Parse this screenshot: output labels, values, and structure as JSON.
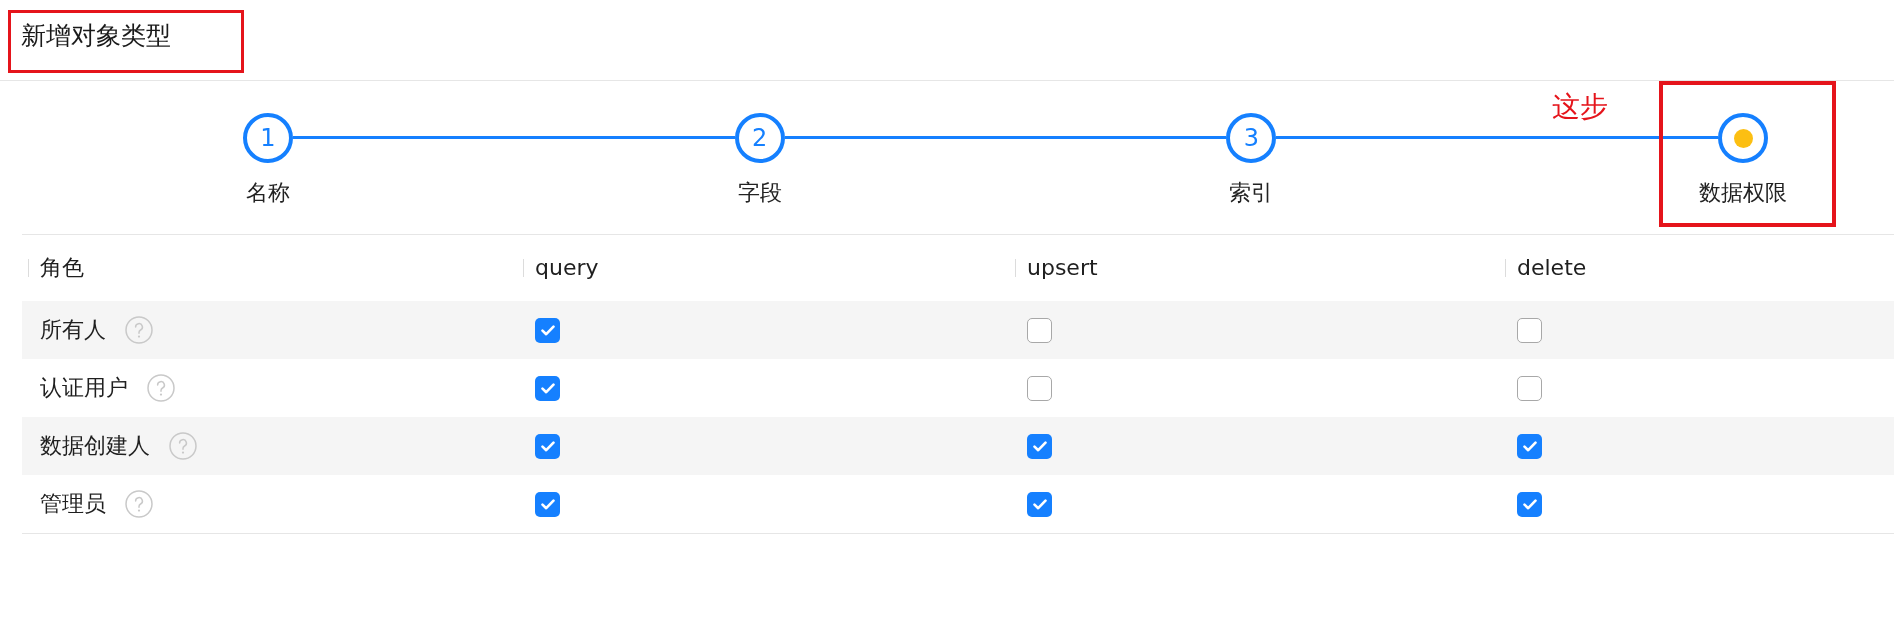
{
  "title": {
    "text": "新增对象类型",
    "highlighted": true
  },
  "steps": [
    {
      "number": "1",
      "label": "名称",
      "current": false,
      "highlighted": false
    },
    {
      "number": "2",
      "label": "字段",
      "current": false,
      "highlighted": false
    },
    {
      "number": "3",
      "label": "索引",
      "current": false,
      "highlighted": false
    },
    {
      "label": "数据权限",
      "current": true,
      "highlighted": true,
      "annotation": "这步"
    }
  ],
  "table": {
    "columns": [
      "角色",
      "query",
      "upsert",
      "delete"
    ],
    "rows": [
      {
        "role": "所有人",
        "help": true,
        "checks": [
          true,
          false,
          false
        ]
      },
      {
        "role": "认证用户",
        "help": true,
        "checks": [
          true,
          false,
          false
        ]
      },
      {
        "role": "数据创建人",
        "help": true,
        "checks": [
          true,
          true,
          true
        ]
      },
      {
        "role": "管理员",
        "help": true,
        "checks": [
          true,
          true,
          true
        ]
      }
    ]
  }
}
